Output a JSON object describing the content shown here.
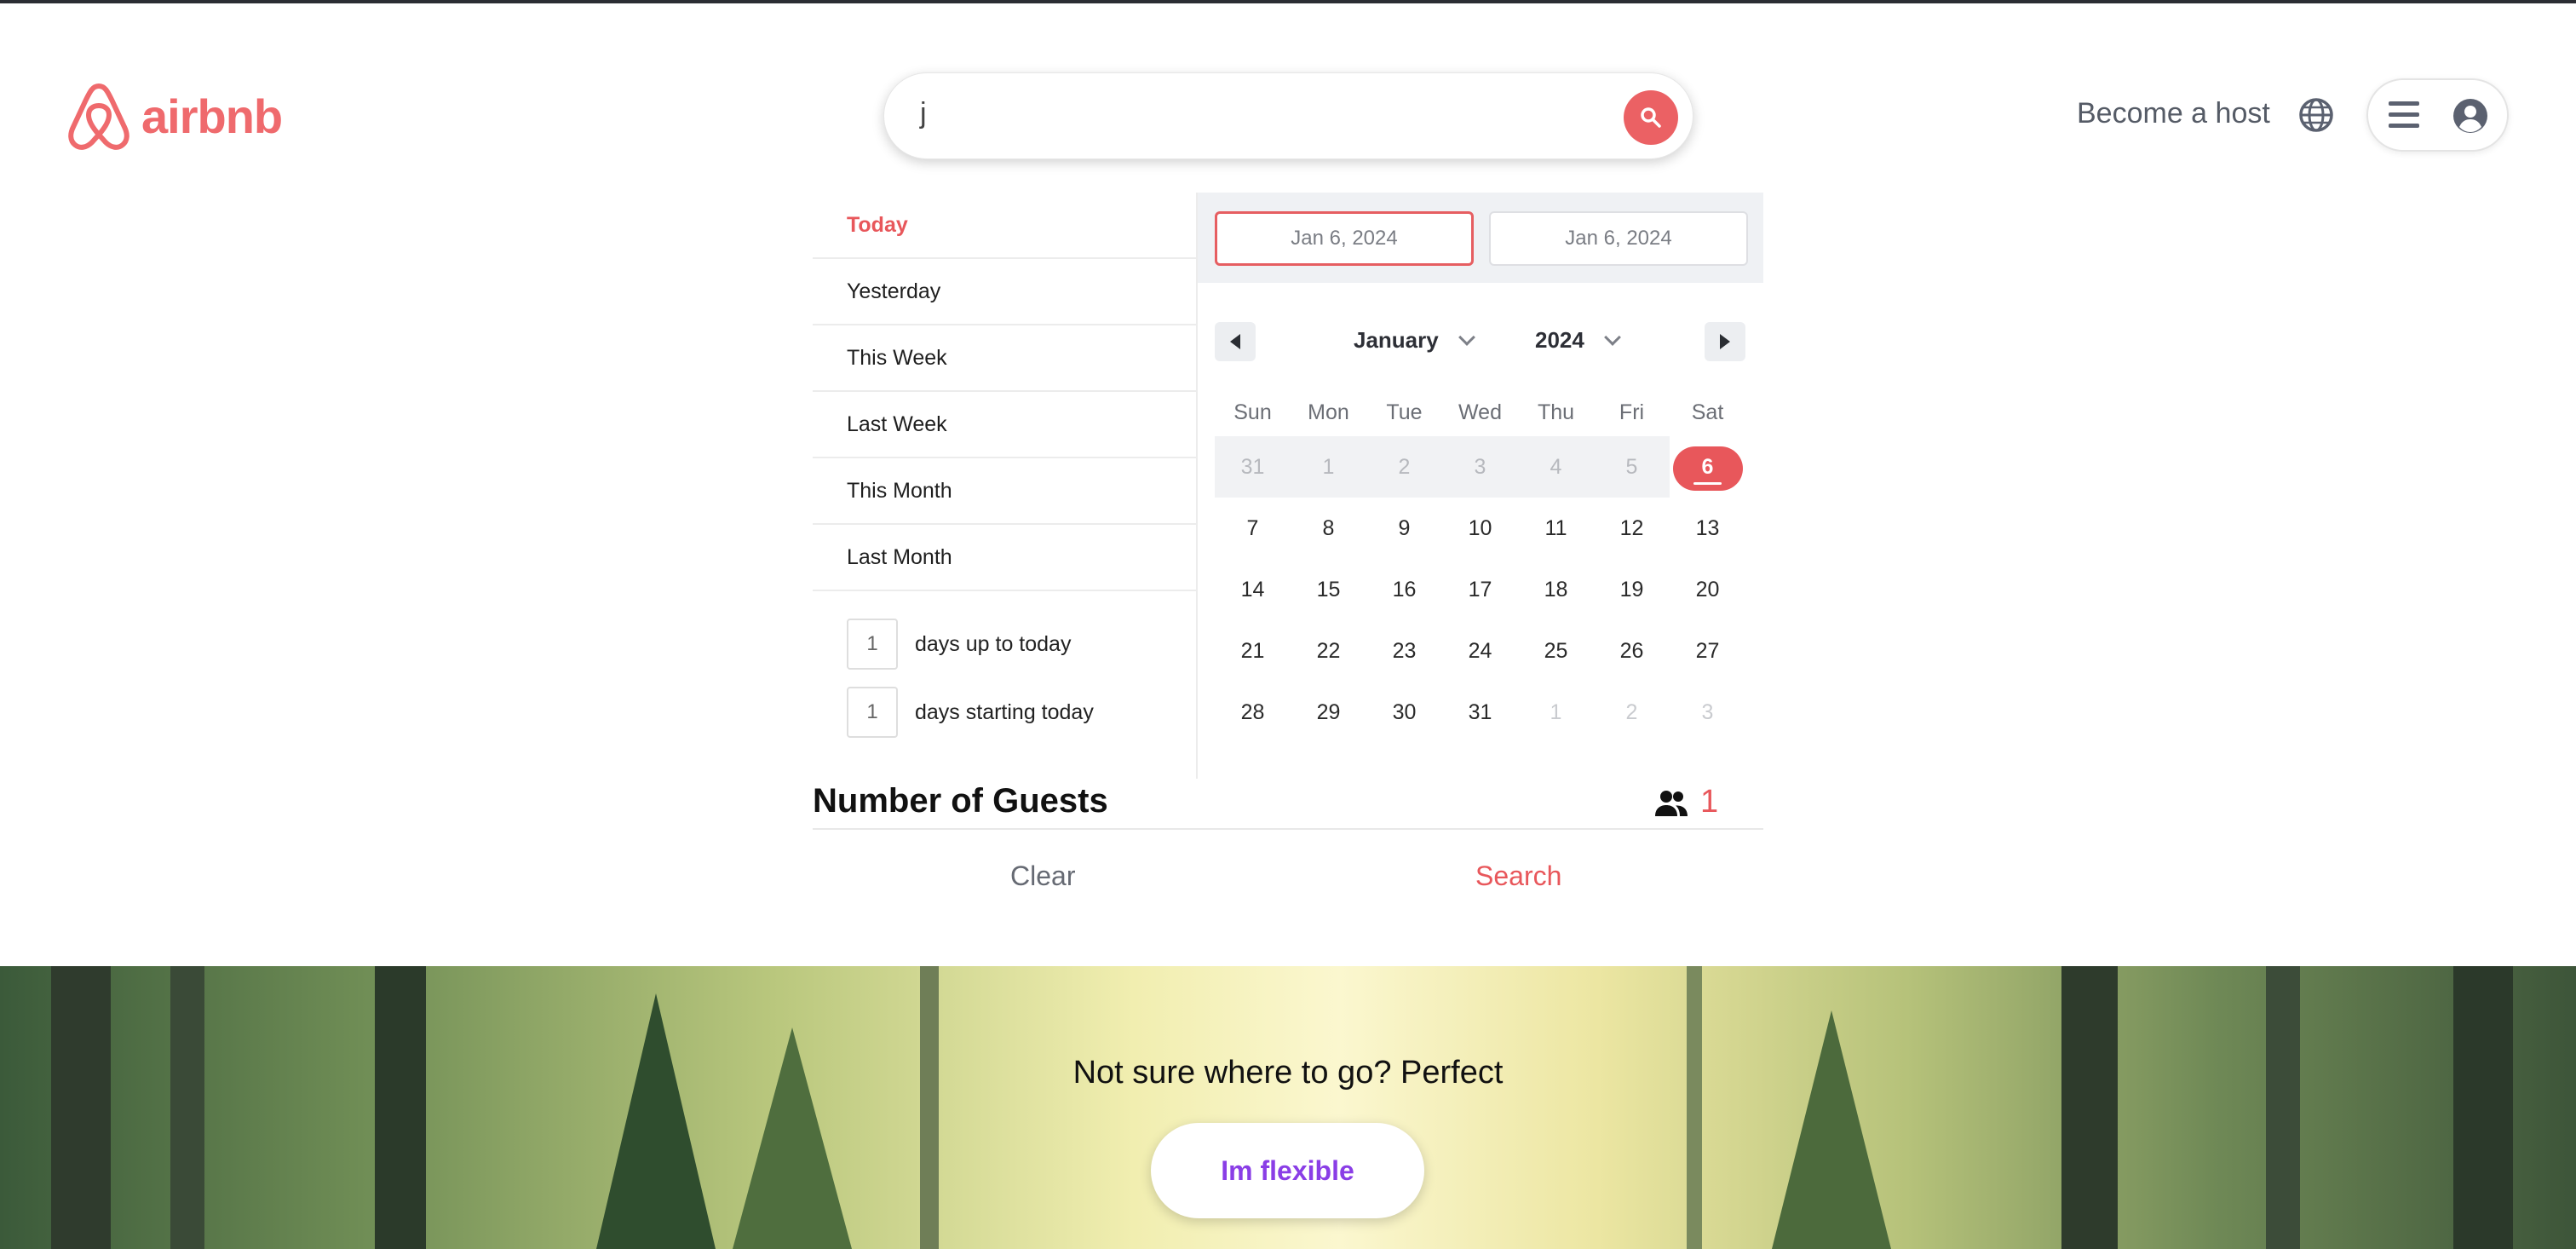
{
  "header": {
    "logo_text": "airbnb",
    "search_query": "j",
    "become_host": "Become a host",
    "brand_color": "#ef6a6d"
  },
  "presets": [
    {
      "label": "Today",
      "active": true
    },
    {
      "label": "Yesterday",
      "active": false
    },
    {
      "label": "This Week",
      "active": false
    },
    {
      "label": "Last Week",
      "active": false
    },
    {
      "label": "This Month",
      "active": false
    },
    {
      "label": "Last Month",
      "active": false
    }
  ],
  "day_inputs": [
    {
      "value": "1",
      "label": "days up to today"
    },
    {
      "value": "1",
      "label": "days starting today"
    }
  ],
  "range": {
    "start": "Jan 6, 2024",
    "end": "Jan 6, 2024"
  },
  "calendar": {
    "month": "January",
    "year": "2024",
    "weekdays": [
      "Sun",
      "Mon",
      "Tue",
      "Wed",
      "Thu",
      "Fri",
      "Sat"
    ],
    "weeks": [
      [
        "31",
        "1",
        "2",
        "3",
        "4",
        "5",
        "6"
      ],
      [
        "7",
        "8",
        "9",
        "10",
        "11",
        "12",
        "13"
      ],
      [
        "14",
        "15",
        "16",
        "17",
        "18",
        "19",
        "20"
      ],
      [
        "21",
        "22",
        "23",
        "24",
        "25",
        "26",
        "27"
      ],
      [
        "28",
        "29",
        "30",
        "31",
        "1",
        "2",
        "3"
      ]
    ],
    "selected_day": "6"
  },
  "guests": {
    "title": "Number of Guests",
    "count": "1"
  },
  "actions": {
    "clear": "Clear",
    "search": "Search"
  },
  "hero": {
    "title": "Not sure where to go? Perfect",
    "button": "Im flexible",
    "button_color": "#8a3ee6"
  }
}
